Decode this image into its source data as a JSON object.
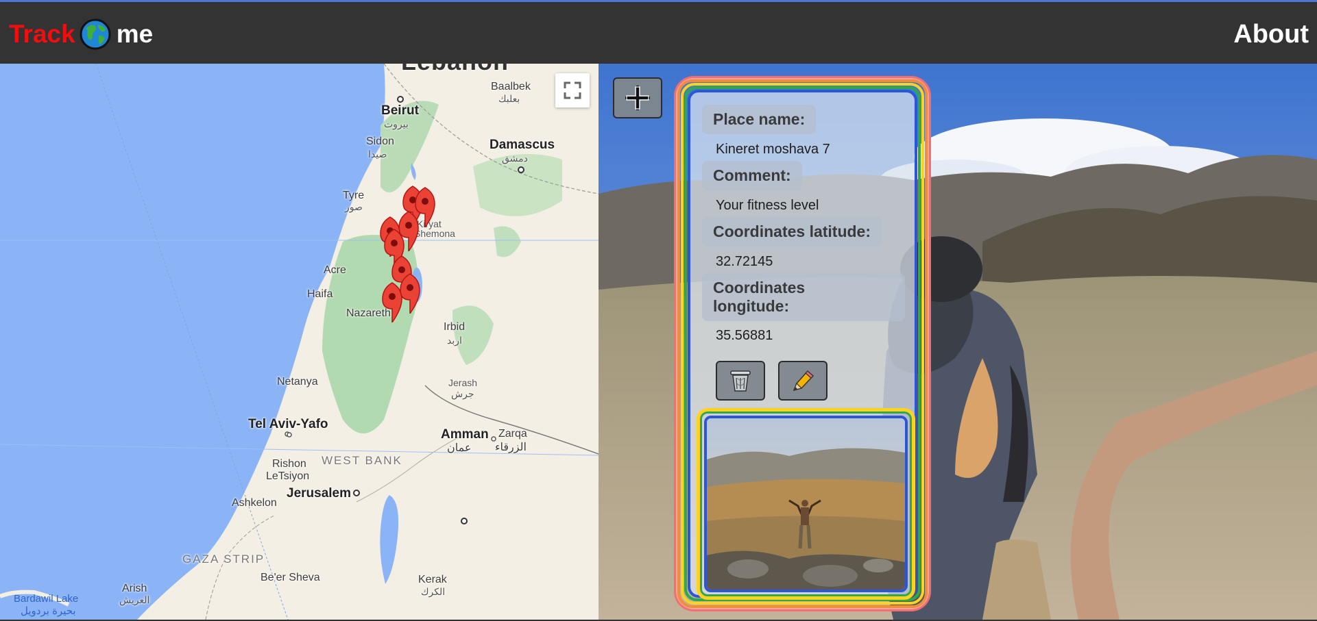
{
  "app": {
    "brand_part1": "Track",
    "brand_part2": "me",
    "globe_icon": "globe-icon",
    "nav_about": "About",
    "colors": {
      "nav_bg": "#333333",
      "brand_red": "#f20e0e",
      "accent_line": "#4f74d6"
    }
  },
  "map": {
    "labels": {
      "lebanon": "Lebanon",
      "baalbek": "Baalbek",
      "baalbek_ar": "بعلبك",
      "beirut": "Beirut",
      "beirut_ar": "بيروت",
      "damascus": "Damascus",
      "damascus_ar": "دمشق",
      "sidon": "Sidon",
      "sidon_ar": "صيدا",
      "tyre": "Tyre",
      "tyre_ar": "صور",
      "kiryat": "Kiryat",
      "shemona": "Shemona",
      "acre": "Acre",
      "haifa": "Haifa",
      "nazareth": "Nazareth",
      "irbid": "Irbid",
      "irbid_ar": "اربد",
      "netanya": "Netanya",
      "jerash": "Jerash",
      "jerash_ar": "جرش",
      "tel_aviv": "Tel Aviv-Yafo",
      "amman": "Amman",
      "amman_ar": "عمان",
      "zarqa": "Zarqa",
      "zarqa_ar": "الزرقاء",
      "west_bank": "WEST BANK",
      "rishon": "Rishon",
      "letsiyon": "LeTsiyon",
      "jerusalem": "Jerusalem",
      "ashkelon": "Ashkelon",
      "gaza_strip": "GAZA STRIP",
      "beer_sheva": "Be'er Sheva",
      "kerak": "Kerak",
      "kerak_ar": "الكرك",
      "arish": "Arish",
      "arish_ar": "العريش",
      "bardawil": "Bardawil Lake",
      "bardawil_ar": "بحيرة بردويل"
    },
    "marker_count": 8,
    "fullscreen_icon": "fullscreen-icon"
  },
  "card": {
    "place_name_label": "Place name:",
    "place_name_value": "Kineret moshava 7",
    "comment_label": "Comment:",
    "comment_value": "Your fitness level",
    "lat_label": "Coordinates latitude:",
    "lat_value": "32.72145",
    "lon_label_1": "Coordinates",
    "lon_label_2": "longitude:",
    "lon_value": "35.56881",
    "delete_icon": "trash-icon",
    "edit_icon": "pencil-icon"
  },
  "toolbar": {
    "add_icon": "plus-icon"
  }
}
